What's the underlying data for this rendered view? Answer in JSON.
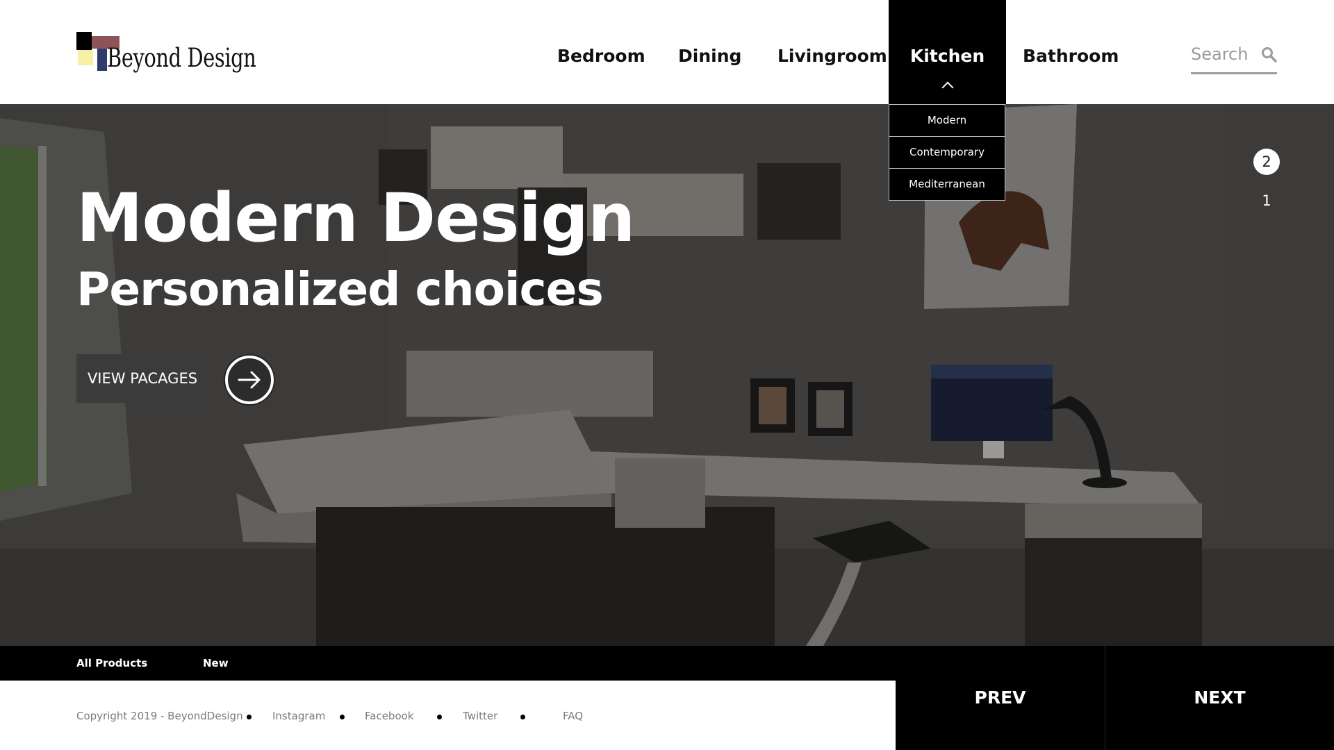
{
  "brand": {
    "name": "Beyond Design",
    "logo_colors": [
      "#000000",
      "#8e5356",
      "#f7efa3",
      "#2f3a6d"
    ]
  },
  "nav": {
    "items": [
      {
        "label": "Bedroom"
      },
      {
        "label": "Dining"
      },
      {
        "label": "Livingroom"
      },
      {
        "label": "Kitchen",
        "active": true
      },
      {
        "label": "Bathroom"
      }
    ],
    "dropdown": [
      "Modern",
      "Contemporary",
      "Mediterranean"
    ]
  },
  "search": {
    "placeholder": "Search",
    "icon": "search-icon"
  },
  "hero": {
    "title": "Modern Design",
    "subtitle": "Personalized choices",
    "cta_label": "VIEW PACAGES",
    "cta_icon": "arrow-right-icon",
    "slides": {
      "current": "2",
      "other": "1"
    }
  },
  "subbar": {
    "links": [
      "All Products",
      "New"
    ]
  },
  "footer": {
    "copyright": "Copyright 2019 - BeyondDesign",
    "links": [
      "Instagram",
      "Facebook",
      "Twitter",
      "FAQ"
    ]
  },
  "pager": {
    "prev_label": "PREV",
    "next_label": "NEXT"
  },
  "colors": {
    "accent": "#000000",
    "hero_overlay": "#4a4846",
    "muted_text": "#7a7a7a"
  }
}
